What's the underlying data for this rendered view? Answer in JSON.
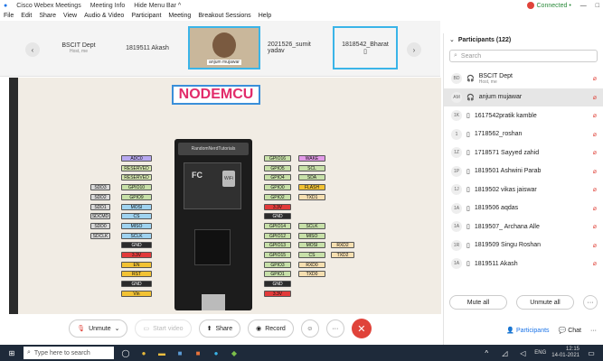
{
  "titlebar": {
    "app": "Cisco Webex Meetings",
    "meeting_info": "Meeting Info",
    "hide_menu": "Hide Menu Bar ^",
    "connected": "Connected",
    "connected_dot": "•"
  },
  "menu": [
    "File",
    "Edit",
    "Share",
    "View",
    "Audio & Video",
    "Participant",
    "Meeting",
    "Breakout Sessions",
    "Help"
  ],
  "videos": {
    "tiles": [
      {
        "name": "BSCIT Dept",
        "sub": "Host, me"
      },
      {
        "name": "1819511 Akash",
        "sub": ""
      },
      {
        "name": "anjum mujawar",
        "sub": ""
      },
      {
        "name": "2021526_sumit yadav",
        "sub": ""
      },
      {
        "name": "1818542_Bharat",
        "sub": ""
      }
    ],
    "prev": "‹",
    "next": "›"
  },
  "slide": {
    "title": "NODEMCU",
    "board_logo": "RandomNerdTutorials",
    "fcc": "FC",
    "wifi": "WiFi",
    "left_pins": {
      "col1": [
        "SDD3",
        "SDD2",
        "SDD1",
        "SDCMD",
        "SDD0",
        "SDCLK"
      ],
      "col2": [
        "ADC0",
        "RESERVED",
        "RESERVED",
        "GPIO10",
        "GPIO9",
        "MOSI",
        "CS",
        "MISO",
        "SCLK",
        "GND",
        "3.3V",
        "EN",
        "RST",
        "GND",
        "Vin"
      ]
    },
    "right_pins": {
      "col1": [
        "GPIO16",
        "GPIO5",
        "GPIO4",
        "GPIO0",
        "GPIO2",
        "3.3V",
        "GND",
        "GPIO14",
        "GPIO12",
        "GPIO13",
        "GPIO15",
        "GPIO3",
        "GPIO1",
        "GND",
        "3.3V"
      ],
      "col2": [
        "WAKE",
        "SCL",
        "SDA",
        "FLASH",
        "TXD1",
        "",
        "",
        "SCLK",
        "MISO",
        "MOSI",
        "CS",
        "RXD0",
        "TXD0",
        "",
        ""
      ],
      "col3": [
        "",
        "",
        "",
        "",
        "",
        "",
        "",
        "",
        "",
        "RXD2",
        "TXD2",
        "",
        "",
        "",
        ""
      ]
    }
  },
  "toolbar": {
    "unmute": "Unmute",
    "start_video": "Start video",
    "share": "Share",
    "record": "Record",
    "more": "···",
    "end": "✕"
  },
  "participants": {
    "header": "Participants (122)",
    "search_placeholder": "Search",
    "list": [
      {
        "initials": "BD",
        "name": "BSCIT Dept",
        "sub": "Host, me",
        "device": "headset"
      },
      {
        "initials": "AM",
        "name": "anjum mujawar",
        "sub": "",
        "device": "headset"
      },
      {
        "initials": "1K",
        "name": "1617542pratik kamble",
        "sub": "",
        "device": "phone"
      },
      {
        "initials": "1",
        "name": "1718562_roshan",
        "sub": "",
        "device": "phone"
      },
      {
        "initials": "1Z",
        "name": "1718571 Sayyed zahid",
        "sub": "",
        "device": "phone"
      },
      {
        "initials": "1P",
        "name": "1819501 Ashwini Parab",
        "sub": "",
        "device": "phone"
      },
      {
        "initials": "1J",
        "name": "1819502 vikas jaiswar",
        "sub": "",
        "device": "phone"
      },
      {
        "initials": "1A",
        "name": "1819506 aqdas",
        "sub": "",
        "device": "phone"
      },
      {
        "initials": "1A",
        "name": "1819507_ Archana Alle",
        "sub": "",
        "device": "phone"
      },
      {
        "initials": "1R",
        "name": "1819509 Singu Roshan",
        "sub": "",
        "device": "phone"
      },
      {
        "initials": "1A",
        "name": "1819511 Akash",
        "sub": "",
        "device": "phone"
      }
    ],
    "mute_all": "Mute all",
    "unmute_all": "Unmute all",
    "tab_participants": "Participants",
    "tab_chat": "Chat"
  },
  "taskbar": {
    "search": "Type here to search",
    "lang": "ENG",
    "time": "12:15",
    "date": "14-01-2021"
  },
  "colors": {
    "accent": "#3ab4e8",
    "end_red": "#e0433a",
    "title_pink": "#e22b6a"
  }
}
